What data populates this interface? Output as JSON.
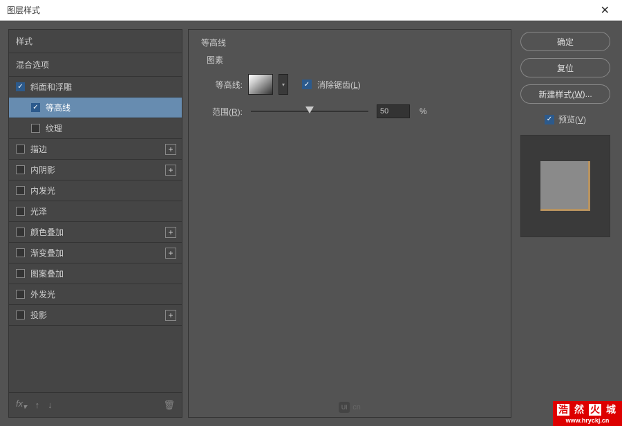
{
  "titlebar": {
    "title": "图层样式"
  },
  "left": {
    "styles_header": "样式",
    "blend_header": "混合选项",
    "items": {
      "bevel": "斜面和浮雕",
      "contour": "等高线",
      "texture": "纹理",
      "stroke": "描边",
      "innerShadow": "内阴影",
      "innerGlow": "内发光",
      "satin": "光泽",
      "colorOverlay": "颜色叠加",
      "gradientOverlay": "渐变叠加",
      "patternOverlay": "图案叠加",
      "outerGlow": "外发光",
      "dropShadow": "投影"
    },
    "fx": "fx"
  },
  "middle": {
    "sectionTitle": "等高线",
    "elementsLabel": "图素",
    "contourLabel": "等高线:",
    "antialiasLabel": "消除锯齿(",
    "antialiasKey": "L",
    "antialiasClose": ")",
    "rangeLabel": "范围(",
    "rangeKey": "R",
    "rangeClose": "):",
    "rangeValue": "50",
    "percent": "%",
    "uiText": "cn"
  },
  "right": {
    "ok": "确定",
    "reset": "复位",
    "newStyle": "新建样式(",
    "newStyleKey": "W",
    "newStyleClose": ")...",
    "preview": "预览(",
    "previewKey": "V",
    "previewClose": ")"
  },
  "watermark": {
    "chars": [
      "浩",
      "然",
      "火",
      "城"
    ],
    "url": "www.hryckj.cn"
  }
}
